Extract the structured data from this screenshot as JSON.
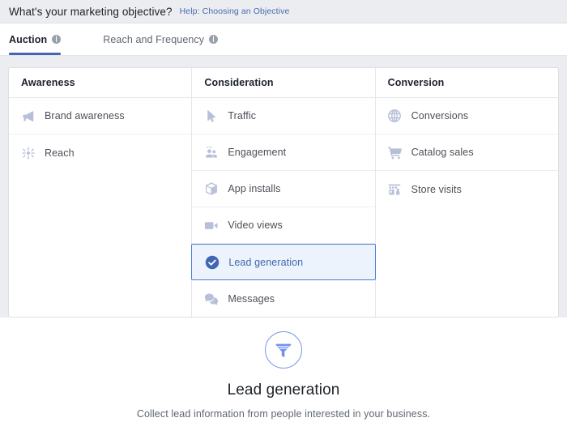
{
  "header": {
    "title": "What's your marketing objective?",
    "help_link": "Help: Choosing an Objective"
  },
  "tabs": [
    {
      "label": "Auction",
      "active": true,
      "has_info_icon": true
    },
    {
      "label": "Reach and Frequency",
      "active": false,
      "has_info_icon": true
    }
  ],
  "columns": [
    {
      "header": "Awareness",
      "items": [
        {
          "label": "Brand awareness",
          "icon": "megaphone-icon",
          "selected": false
        },
        {
          "label": "Reach",
          "icon": "reach-starburst-icon",
          "selected": false
        }
      ]
    },
    {
      "header": "Consideration",
      "items": [
        {
          "label": "Traffic",
          "icon": "cursor-arrow-icon",
          "selected": false
        },
        {
          "label": "Engagement",
          "icon": "people-icon",
          "selected": false
        },
        {
          "label": "App installs",
          "icon": "cube-box-icon",
          "selected": false
        },
        {
          "label": "Video views",
          "icon": "video-camera-icon",
          "selected": false
        },
        {
          "label": "Lead generation",
          "icon": "check-circle-icon",
          "selected": true
        },
        {
          "label": "Messages",
          "icon": "chat-bubbles-icon",
          "selected": false
        }
      ]
    },
    {
      "header": "Conversion",
      "items": [
        {
          "label": "Conversions",
          "icon": "globe-icon",
          "selected": false
        },
        {
          "label": "Catalog sales",
          "icon": "shopping-cart-icon",
          "selected": false
        },
        {
          "label": "Store visits",
          "icon": "storefront-icon",
          "selected": false
        }
      ]
    }
  ],
  "detail": {
    "icon": "funnel-icon",
    "title": "Lead generation",
    "description": "Collect lead information from people interested in your business."
  },
  "colors": {
    "accent_blue": "#4267b2",
    "link_blue": "#4b6ab3",
    "selected_bg": "#edf3fc",
    "selected_border": "#4a7fd0",
    "icon_gray": "#b7c0d8",
    "header_bg": "#ebedf0",
    "detail_icon_blue": "#6e93ed"
  }
}
